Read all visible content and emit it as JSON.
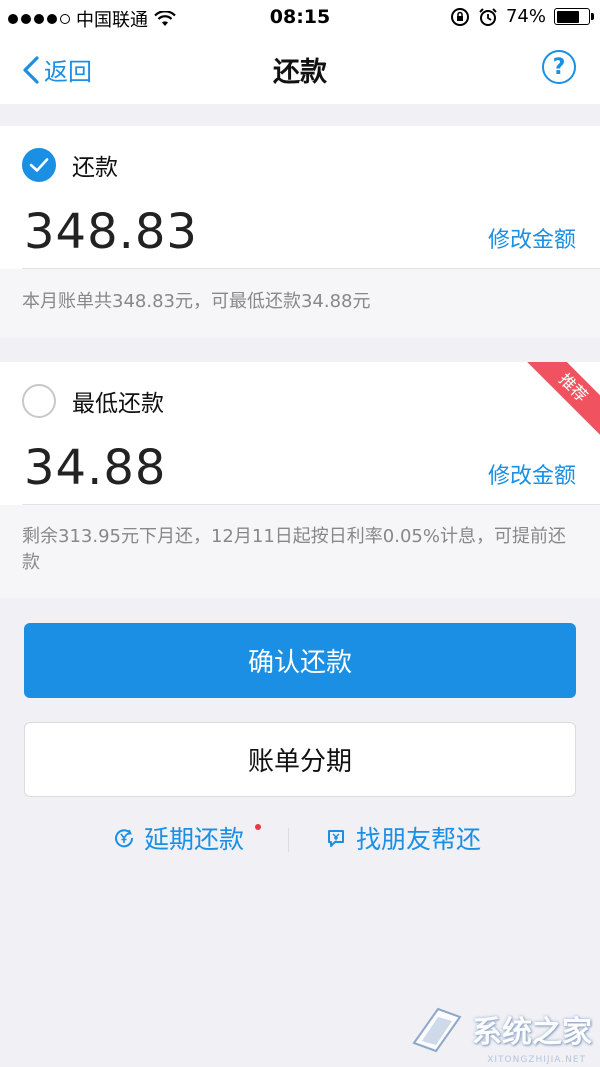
{
  "status_bar": {
    "carrier": "中国联通",
    "time": "08:15",
    "battery": "74%",
    "battery_level": 0.74
  },
  "nav": {
    "back_label": "返回",
    "title": "还款",
    "help_label": "?"
  },
  "options": [
    {
      "label": "还款",
      "checked": true,
      "amount": "348.83",
      "modify_label": "修改金额",
      "note": "本月账单共348.83元，可最低还款34.88元"
    },
    {
      "label": "最低还款",
      "checked": false,
      "amount": "34.88",
      "modify_label": "修改金额",
      "note": "剩余313.95元下月还，12月11日起按日利率0.05%计息，可提前还款",
      "badge": "推荐"
    }
  ],
  "actions": {
    "confirm_label": "确认还款",
    "installment_label": "账单分期"
  },
  "links": {
    "defer_label": "延期还款",
    "friend_label": "找朋友帮还"
  },
  "watermark": {
    "text": "系统之家",
    "sub": "XITONGZHIJIA.NET"
  },
  "colors": {
    "accent": "#1a8fe3",
    "ribbon": "#f0535f",
    "background": "#f0f0f5"
  }
}
